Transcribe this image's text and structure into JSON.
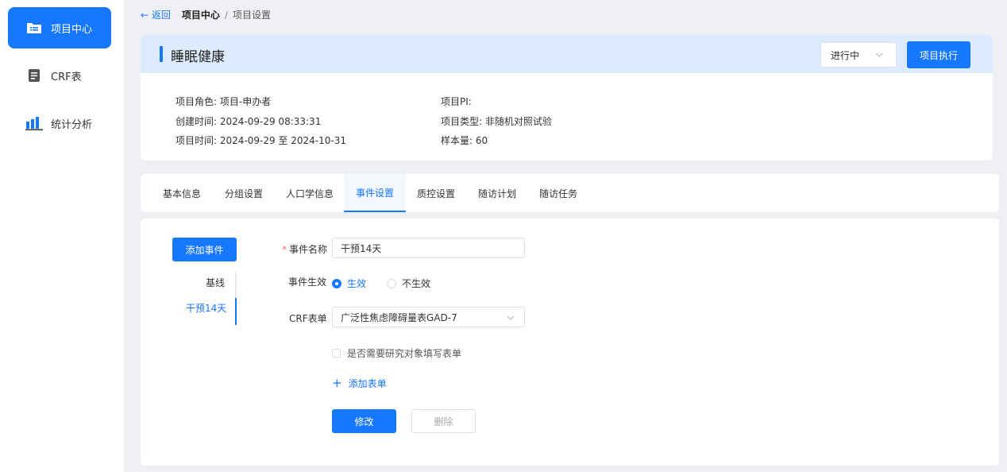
{
  "sidebar": {
    "items": [
      {
        "label": "项目中心",
        "icon": "folder-list-icon",
        "active": true
      },
      {
        "label": "CRF表",
        "icon": "document-icon",
        "active": false
      },
      {
        "label": "统计分析",
        "icon": "bar-chart-icon",
        "active": false
      }
    ]
  },
  "breadcrumb": {
    "back": "← 返回",
    "current": "项目中心",
    "separator": "/",
    "last": "项目设置"
  },
  "project": {
    "title": "睡眠健康",
    "status": "进行中",
    "exec_button": "项目执行",
    "role_label": "项目角色:",
    "role_value": "项目-申办者",
    "created_label": "创建时间:",
    "created_value": "2024-09-29 08:33:31",
    "period_label": "项目时间:",
    "period_value": "2024-09-29 至 2024-10-31",
    "pi_label": "项目PI:",
    "pi_value": "",
    "type_label": "项目类型:",
    "type_value": "非随机对照试验",
    "sample_label": "样本量:",
    "sample_value": "60"
  },
  "tabs": [
    {
      "label": "基本信息"
    },
    {
      "label": "分组设置"
    },
    {
      "label": "人口学信息"
    },
    {
      "label": "事件设置",
      "active": true
    },
    {
      "label": "质控设置"
    },
    {
      "label": "随访计划"
    },
    {
      "label": "随访任务"
    }
  ],
  "event": {
    "add_button": "添加事件",
    "list": [
      "基线",
      "干预14天"
    ],
    "name_label": "事件名称",
    "name_value": "干预14天",
    "effect_label": "事件生效",
    "effect_on": "生效",
    "effect_off": "不生效",
    "crf_label": "CRF表单",
    "crf_value": "广泛性焦虑障碍量表GAD-7",
    "checkbox_label": "是否需要研究对象填写表单",
    "add_form": "添加表单",
    "edit_button": "修改",
    "delete_button": "删除"
  },
  "colors": {
    "accent": "#1677ff",
    "header_bg": "#dcebfd",
    "page_bg": "#eef0f3"
  }
}
